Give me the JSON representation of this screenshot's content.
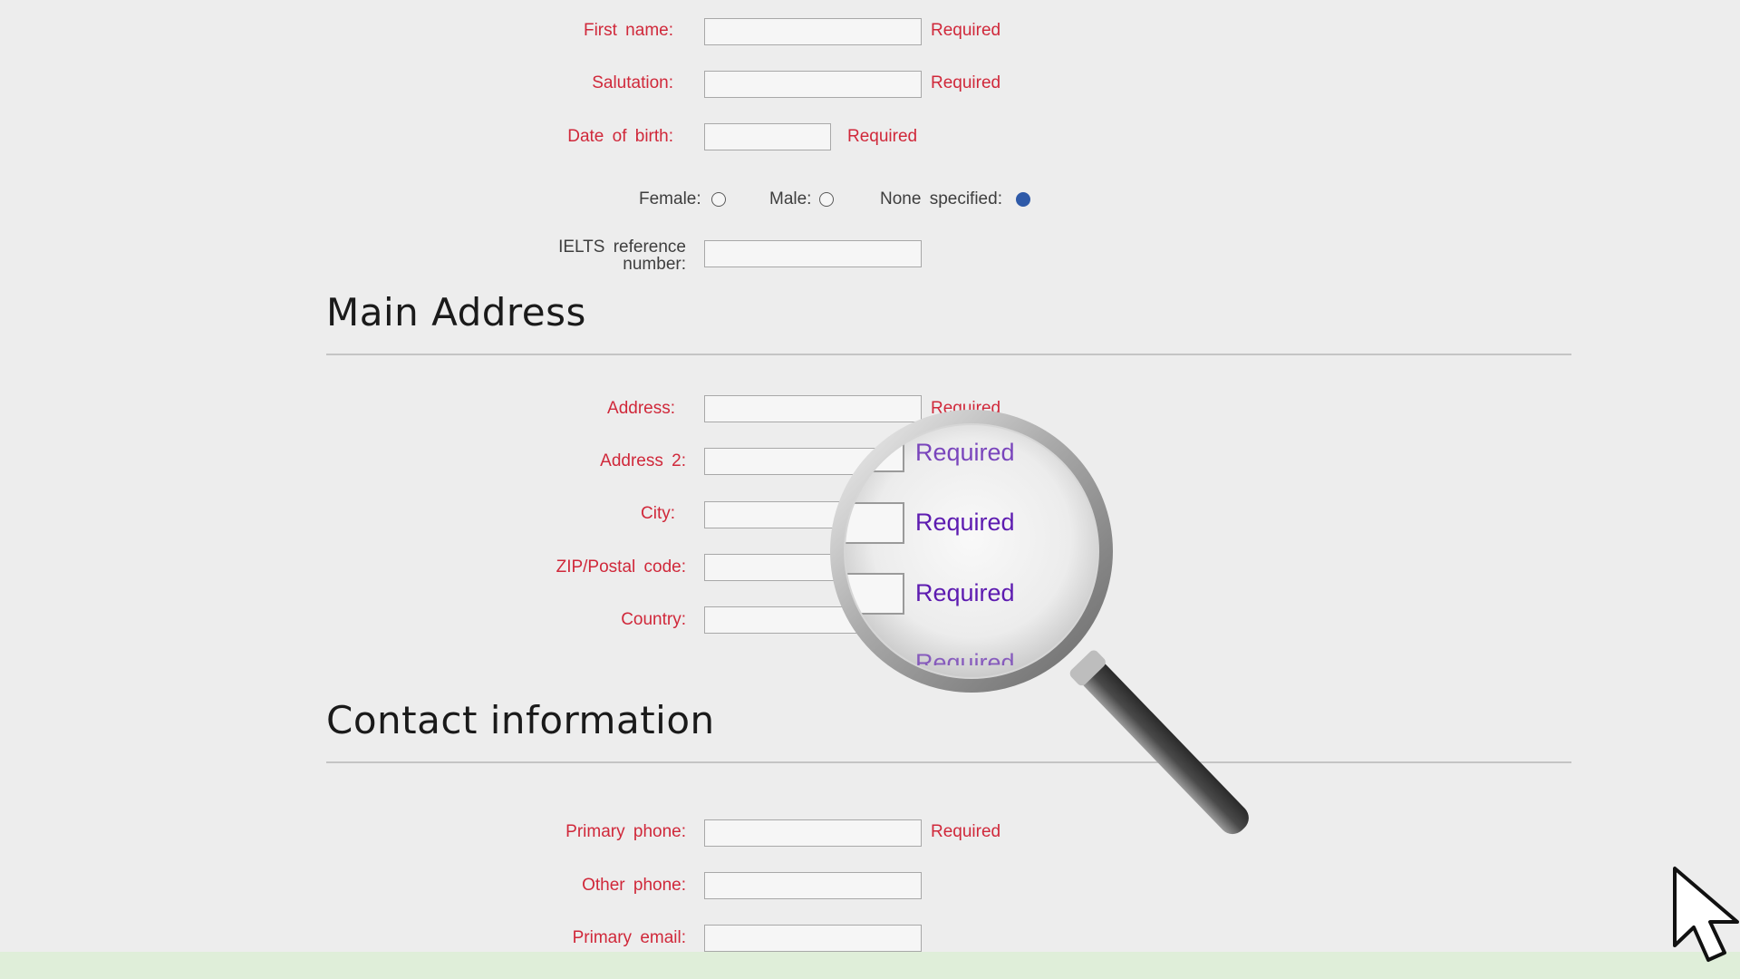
{
  "form": {
    "personal": {
      "first_name_label": "First name:",
      "salutation_label": "Salutation:",
      "dob_label": "Date of birth:",
      "ielts_label_line1": "IELTS reference",
      "ielts_label_line2": "number:",
      "required": "Required",
      "first_name_value": "",
      "salutation_value": "",
      "dob_value": "",
      "ielts_value": "",
      "gender": {
        "female_label": "Female:",
        "male_label": "Male:",
        "none_label": "None specified:",
        "selected": "None specified"
      }
    },
    "main_address": {
      "heading": "Main Address",
      "address_label": "Address:",
      "address2_label": "Address 2:",
      "city_label": "City:",
      "zip_label": "ZIP/Postal code:",
      "country_label": "Country:",
      "required": "Required"
    },
    "contact": {
      "heading": "Contact information",
      "primary_phone_label": "Primary phone:",
      "other_phone_label": "Other phone:",
      "primary_email_label": "Primary email:",
      "required": "Required"
    }
  },
  "magnifier": {
    "lines": [
      "Required",
      "Required",
      "Required",
      "Required"
    ]
  },
  "colors": {
    "background": "#ededed",
    "label_red": "#d0283a",
    "label_dark": "#3e3e3e",
    "radio_selected": "#2f5aa8",
    "magnified_text": "#5d1bb0",
    "bottom_bar": "#dfeed9"
  },
  "icons": {
    "magnifier": "magnifying-glass-icon",
    "cursor": "mouse-pointer-icon"
  }
}
